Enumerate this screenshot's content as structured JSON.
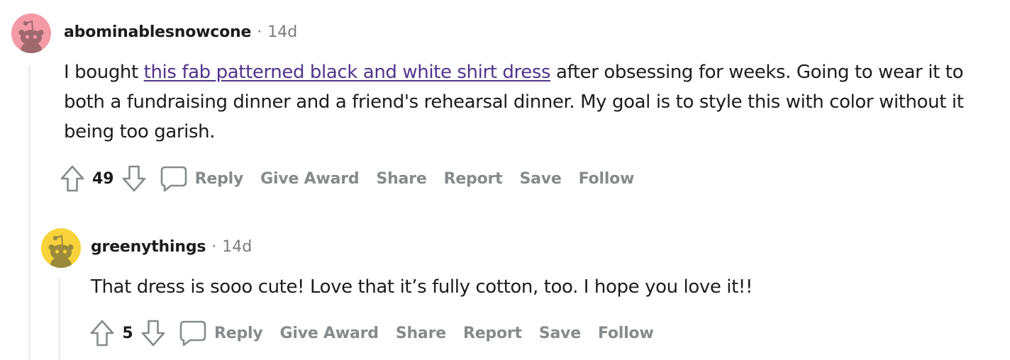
{
  "comments": [
    {
      "username": "abominablesnowcone",
      "separator": "·",
      "age": "14d",
      "avatar_color": "#f39aa6",
      "avatar_icon": "snoo-avatar-icon",
      "text_before": "I bought ",
      "link_text": "this fab patterned black and white shirt dress",
      "text_after": " after obsessing for weeks. Going to wear it to both a fundraising dinner and a friend's rehearsal dinner. My goal is to style this with color without it being too garish.",
      "score": "49",
      "actions": {
        "reply": "Reply",
        "give_award": "Give Award",
        "share": "Share",
        "report": "Report",
        "save": "Save",
        "follow": "Follow"
      }
    },
    {
      "username": "greenythings",
      "separator": "·",
      "age": "14d",
      "avatar_color": "#f7d23a",
      "avatar_icon": "snoo-avatar-icon",
      "text": "That dress is sooo cute! Love that it’s fully cotton, too. I hope you love it!!",
      "score": "5",
      "actions": {
        "reply": "Reply",
        "give_award": "Give Award",
        "share": "Share",
        "report": "Report",
        "save": "Save",
        "follow": "Follow"
      }
    }
  ],
  "colors": {
    "link": "#52348b",
    "action_text": "#878a8c",
    "meta_text": "#7c7c7c",
    "thread_line": "#edeff1"
  }
}
